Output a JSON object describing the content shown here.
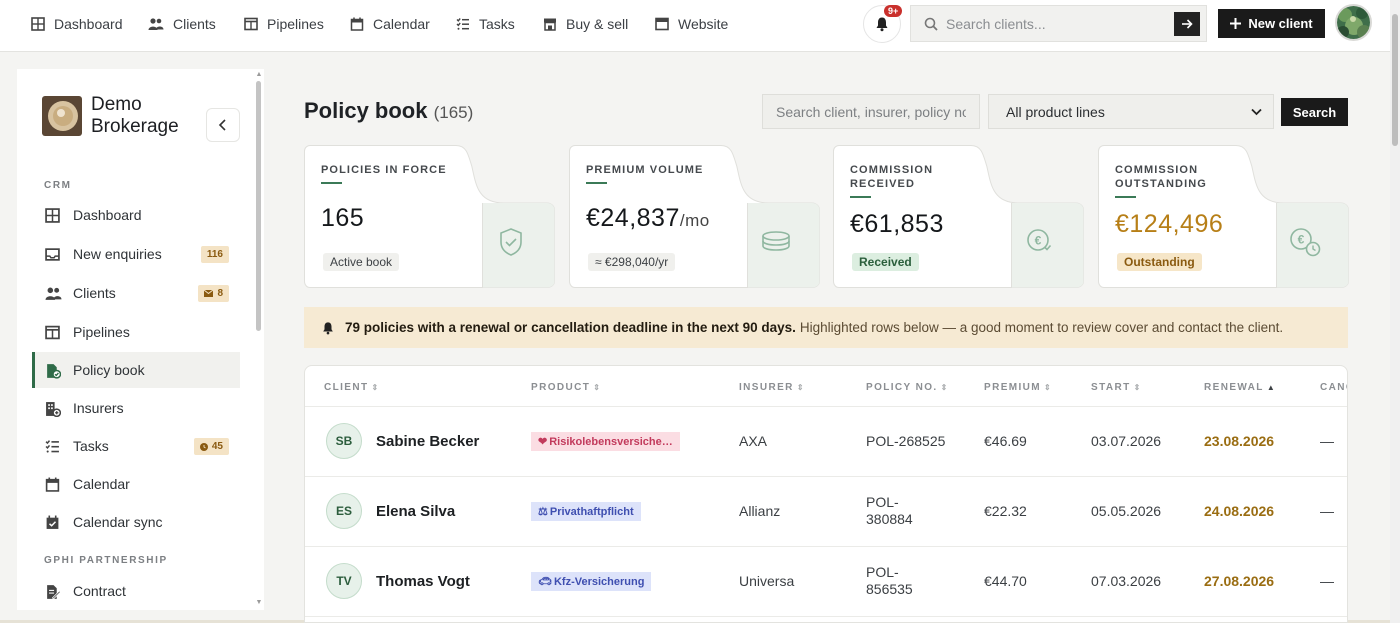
{
  "nav": {
    "items": [
      {
        "label": "Dashboard",
        "icon": "grid-icon"
      },
      {
        "label": "Clients",
        "icon": "users-icon"
      },
      {
        "label": "Pipelines",
        "icon": "columns-icon"
      },
      {
        "label": "Calendar",
        "icon": "calendar-icon"
      },
      {
        "label": "Tasks",
        "icon": "checklist-icon"
      },
      {
        "label": "Buy & sell",
        "icon": "store-icon"
      },
      {
        "label": "Website",
        "icon": "browser-icon"
      }
    ],
    "notifications_badge": "9+",
    "search_placeholder": "Search clients...",
    "new_client_label": "New client"
  },
  "sidebar": {
    "brand_name": "Demo Brokerage",
    "section_crm": "CRM",
    "section_partnership": "GPHI PARTNERSHIP",
    "items": [
      {
        "label": "Dashboard",
        "icon": "grid-icon"
      },
      {
        "label": "New enquiries",
        "icon": "inbox-icon",
        "count": "116"
      },
      {
        "label": "Clients",
        "icon": "users-icon",
        "count": "8",
        "count_icon": "mail-icon"
      },
      {
        "label": "Pipelines",
        "icon": "columns-icon"
      },
      {
        "label": "Policy book",
        "icon": "policy-book-icon",
        "active": true
      },
      {
        "label": "Insurers",
        "icon": "building-icon"
      },
      {
        "label": "Tasks",
        "icon": "checklist-icon",
        "count": "45",
        "count_icon": "clock-icon"
      },
      {
        "label": "Calendar",
        "icon": "calendar-icon"
      },
      {
        "label": "Calendar sync",
        "icon": "calendar-check-icon"
      },
      {
        "label": "Contract",
        "icon": "contract-icon"
      }
    ]
  },
  "page": {
    "title": "Policy book",
    "count": "(165)",
    "search_placeholder": "Search client, insurer, policy no.",
    "product_filter": "All product lines",
    "search_button": "Search"
  },
  "stats": [
    {
      "title": "POLICIES IN FORCE",
      "value": "165",
      "unit": "",
      "pill": "Active book",
      "icon": "shield-check-icon"
    },
    {
      "title": "PREMIUM VOLUME",
      "value": "€24,837",
      "unit": "/mo",
      "pill": "≈ €298,040/yr",
      "icon": "coins-icon"
    },
    {
      "title": "COMMISSION RECEIVED",
      "value": "€61,853",
      "unit": "",
      "pill": "Received",
      "icon": "euro-check-icon"
    },
    {
      "title": "COMMISSION OUTSTANDING",
      "value": "€124,496",
      "unit": "",
      "pill": "Outstanding",
      "icon": "euro-clock-icon"
    }
  ],
  "banner": {
    "bold": "79 policies with a renewal or cancellation deadline in the next 90 days.",
    "text": "Highlighted rows below — a good moment to review cover and contact the client."
  },
  "table": {
    "columns": [
      "CLIENT",
      "PRODUCT",
      "INSURER",
      "POLICY NO.",
      "PREMIUM",
      "START",
      "RENEWAL",
      "CANC"
    ],
    "sorted_column": "RENEWAL",
    "sort_direction": "ascending",
    "rows": [
      {
        "initials": "SB",
        "client": "Sabine Becker",
        "product": "Risikolebensversiche…",
        "product_icon": "heart-icon",
        "product_style": "pink",
        "insurer": "AXA",
        "policy_no": "POL-268525",
        "premium": "€46.69",
        "start": "03.07.2026",
        "renewal": "23.08.2026",
        "cancellation": "—"
      },
      {
        "initials": "ES",
        "client": "Elena Silva",
        "product": "Privathaftpflicht",
        "product_icon": "scales-icon",
        "product_style": "blue",
        "insurer": "Allianz",
        "policy_no": "POL-380884",
        "premium": "€22.32",
        "start": "05.05.2026",
        "renewal": "24.08.2026",
        "cancellation": "—"
      },
      {
        "initials": "TV",
        "client": "Thomas Vogt",
        "product": "Kfz-Versicherung",
        "product_icon": "car-icon",
        "product_style": "blue",
        "insurer": "Universa",
        "policy_no": "POL-856535",
        "premium": "€44.70",
        "start": "07.03.2026",
        "renewal": "27.08.2026",
        "cancellation": "—"
      }
    ]
  },
  "colors": {
    "accent_green": "#2f6b48",
    "renewal_highlight": "#9a6d12",
    "banner_bg": "#f6ead3",
    "primary_button": "#1a1a1a"
  }
}
